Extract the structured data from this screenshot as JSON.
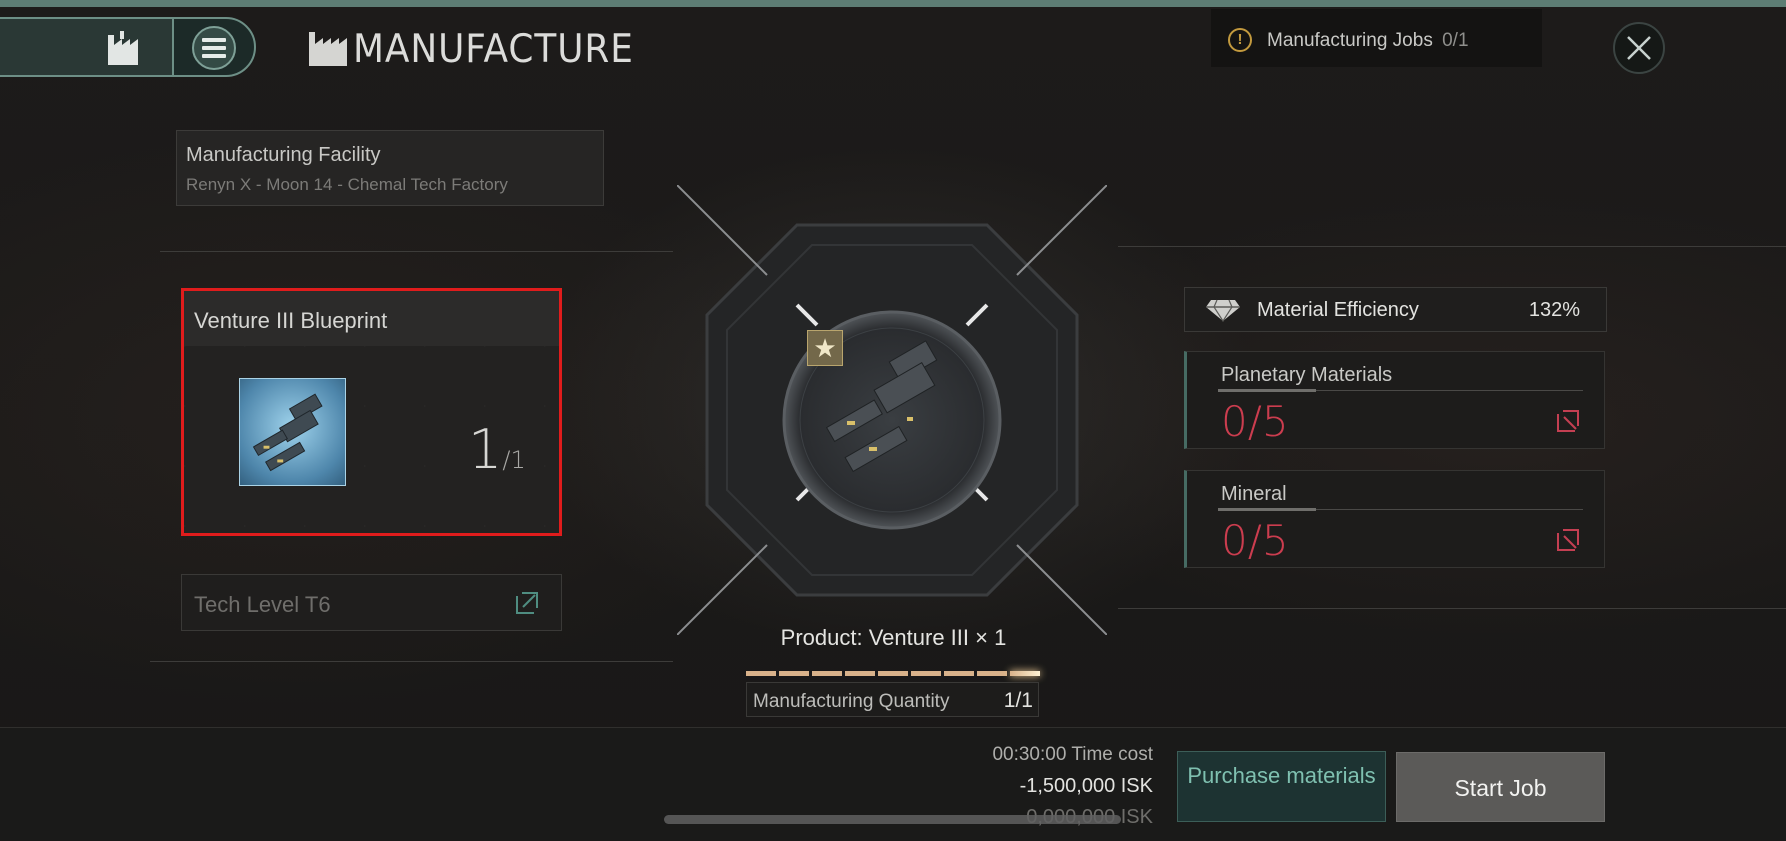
{
  "header": {
    "title": "MANUFACTURE",
    "jobs_label": "Manufacturing Jobs",
    "jobs_count": "0/1",
    "icons": [
      "factory-icon",
      "menu-icon",
      "close-icon",
      "warning-icon"
    ]
  },
  "facility": {
    "label": "Manufacturing Facility",
    "value": "Renyn X - Moon 14 - Chemal Tech Factory"
  },
  "blueprint": {
    "name": "Venture III Blueprint",
    "quantity": "1",
    "quantity_total": "/1"
  },
  "tech_level": "Tech Level T6",
  "product": {
    "label": "Product: Venture III × 1",
    "quantity_label": "Manufacturing Quantity",
    "quantity_value": "1/1",
    "quantity_fill": 1.0
  },
  "materials": {
    "efficiency_label": "Material Efficiency",
    "efficiency_value": "132%",
    "planetary_label": "Planetary Materials",
    "planetary_value": "0/5",
    "mineral_label": "Mineral",
    "mineral_value": "0/5"
  },
  "footer": {
    "time": "00:30:00  Time cost",
    "cost": "-1,500,000 ISK",
    "balance": "0,000,000 ISK",
    "purchase_label": "Purchase materials",
    "start_label": "Start Job"
  },
  "colors": {
    "accent_teal": "#6d8f86",
    "highlight_red": "#e01c1c",
    "shortage_red": "#cc3d4f",
    "progress_gold": "#d9b28a"
  }
}
